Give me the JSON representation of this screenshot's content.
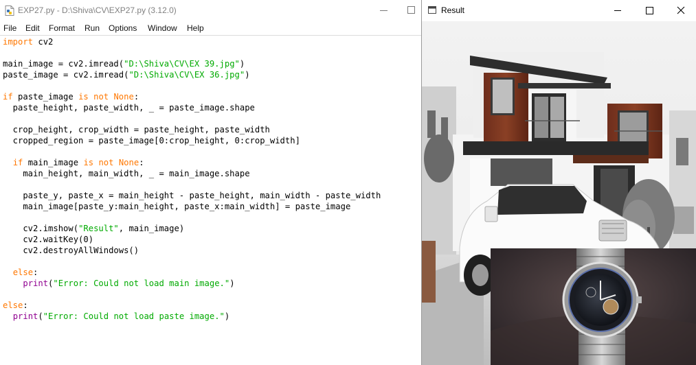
{
  "editor": {
    "title": "EXP27.py - D:\\Shiva\\CV\\EXP27.py (3.12.0)",
    "menu": [
      "File",
      "Edit",
      "Format",
      "Run",
      "Options",
      "Window",
      "Help"
    ],
    "code_lines": [
      "import cv2",
      "",
      "main_image = cv2.imread(\"D:\\Shiva\\CV\\EX 39.jpg\")",
      "paste_image = cv2.imread(\"D:\\Shiva\\CV\\EX 36.jpg\")",
      "",
      "if paste_image is not None:",
      "  paste_height, paste_width, _ = paste_image.shape",
      "",
      "  crop_height, crop_width = paste_height, paste_width",
      "  cropped_region = paste_image[0:crop_height, 0:crop_width]",
      "",
      "  if main_image is not None:",
      "    main_height, main_width, _ = main_image.shape",
      "",
      "    paste_y, paste_x = main_height - paste_height, main_width - paste_width",
      "    main_image[paste_y:main_height, paste_x:main_width] = paste_image",
      "",
      "    cv2.imshow(\"Result\", main_image)",
      "    cv2.waitKey(0)",
      "    cv2.destroyAllWindows()",
      "",
      "  else:",
      "    print(\"Error: Could not load main image.\")",
      "",
      "else:",
      "  print(\"Error: Could not load paste image.\")"
    ],
    "syntax_colors": {
      "keyword": "#ff7700",
      "string": "#00aa00",
      "builtin": "#900090",
      "default": "#000000"
    }
  },
  "result_window": {
    "title": "Result",
    "icons": {
      "minimize": "minimize-icon",
      "maximize": "maximize-icon",
      "close": "close-icon"
    },
    "images": [
      "house-photo",
      "watch-photo"
    ]
  }
}
